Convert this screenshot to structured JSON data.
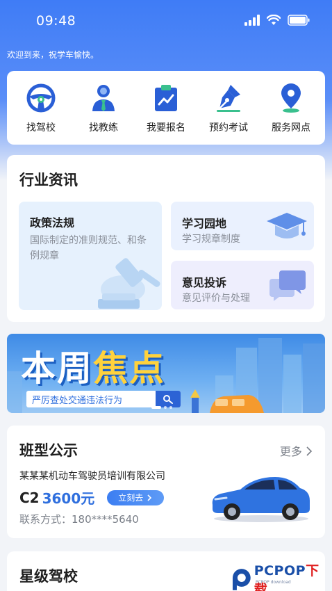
{
  "status_bar": {
    "time": "09:48"
  },
  "welcome_text": "欢迎到来，祝学车愉快。",
  "quick_nav": [
    {
      "label": "找驾校",
      "icon": "steering-wheel-icon"
    },
    {
      "label": "找教练",
      "icon": "coach-person-icon"
    },
    {
      "label": "我要报名",
      "icon": "clipboard-chart-icon"
    },
    {
      "label": "预约考试",
      "icon": "pen-nib-icon"
    },
    {
      "label": "服务网点",
      "icon": "map-pin-icon"
    }
  ],
  "industry_news": {
    "title": "行业资讯",
    "policy": {
      "title": "政策法规",
      "desc": "国际制定的准则规范、和条例规章"
    },
    "study": {
      "title": "学习园地",
      "desc": "学习规章制度"
    },
    "feedback": {
      "title": "意见投诉",
      "desc": "意见评价与处理"
    }
  },
  "banner": {
    "title_part1": "本周",
    "title_part2": "焦点",
    "search_text": "严厉查处交通违法行为"
  },
  "class_announcement": {
    "title": "班型公示",
    "more": "更多",
    "company": "某某某机动车驾驶员培训有限公司",
    "license_type": "C2",
    "price": "3600元",
    "action": "立刻去",
    "contact": "联系方式：180****5640"
  },
  "star_schools": {
    "title": "星级驾校"
  },
  "watermark": {
    "text_main": "PCPOP",
    "text_accent": "下载",
    "sub": "PCPOP download"
  },
  "colors": {
    "primary": "#3f7cf6",
    "accent": "#2f6fde",
    "banner_yellow": "#ffd23c"
  }
}
